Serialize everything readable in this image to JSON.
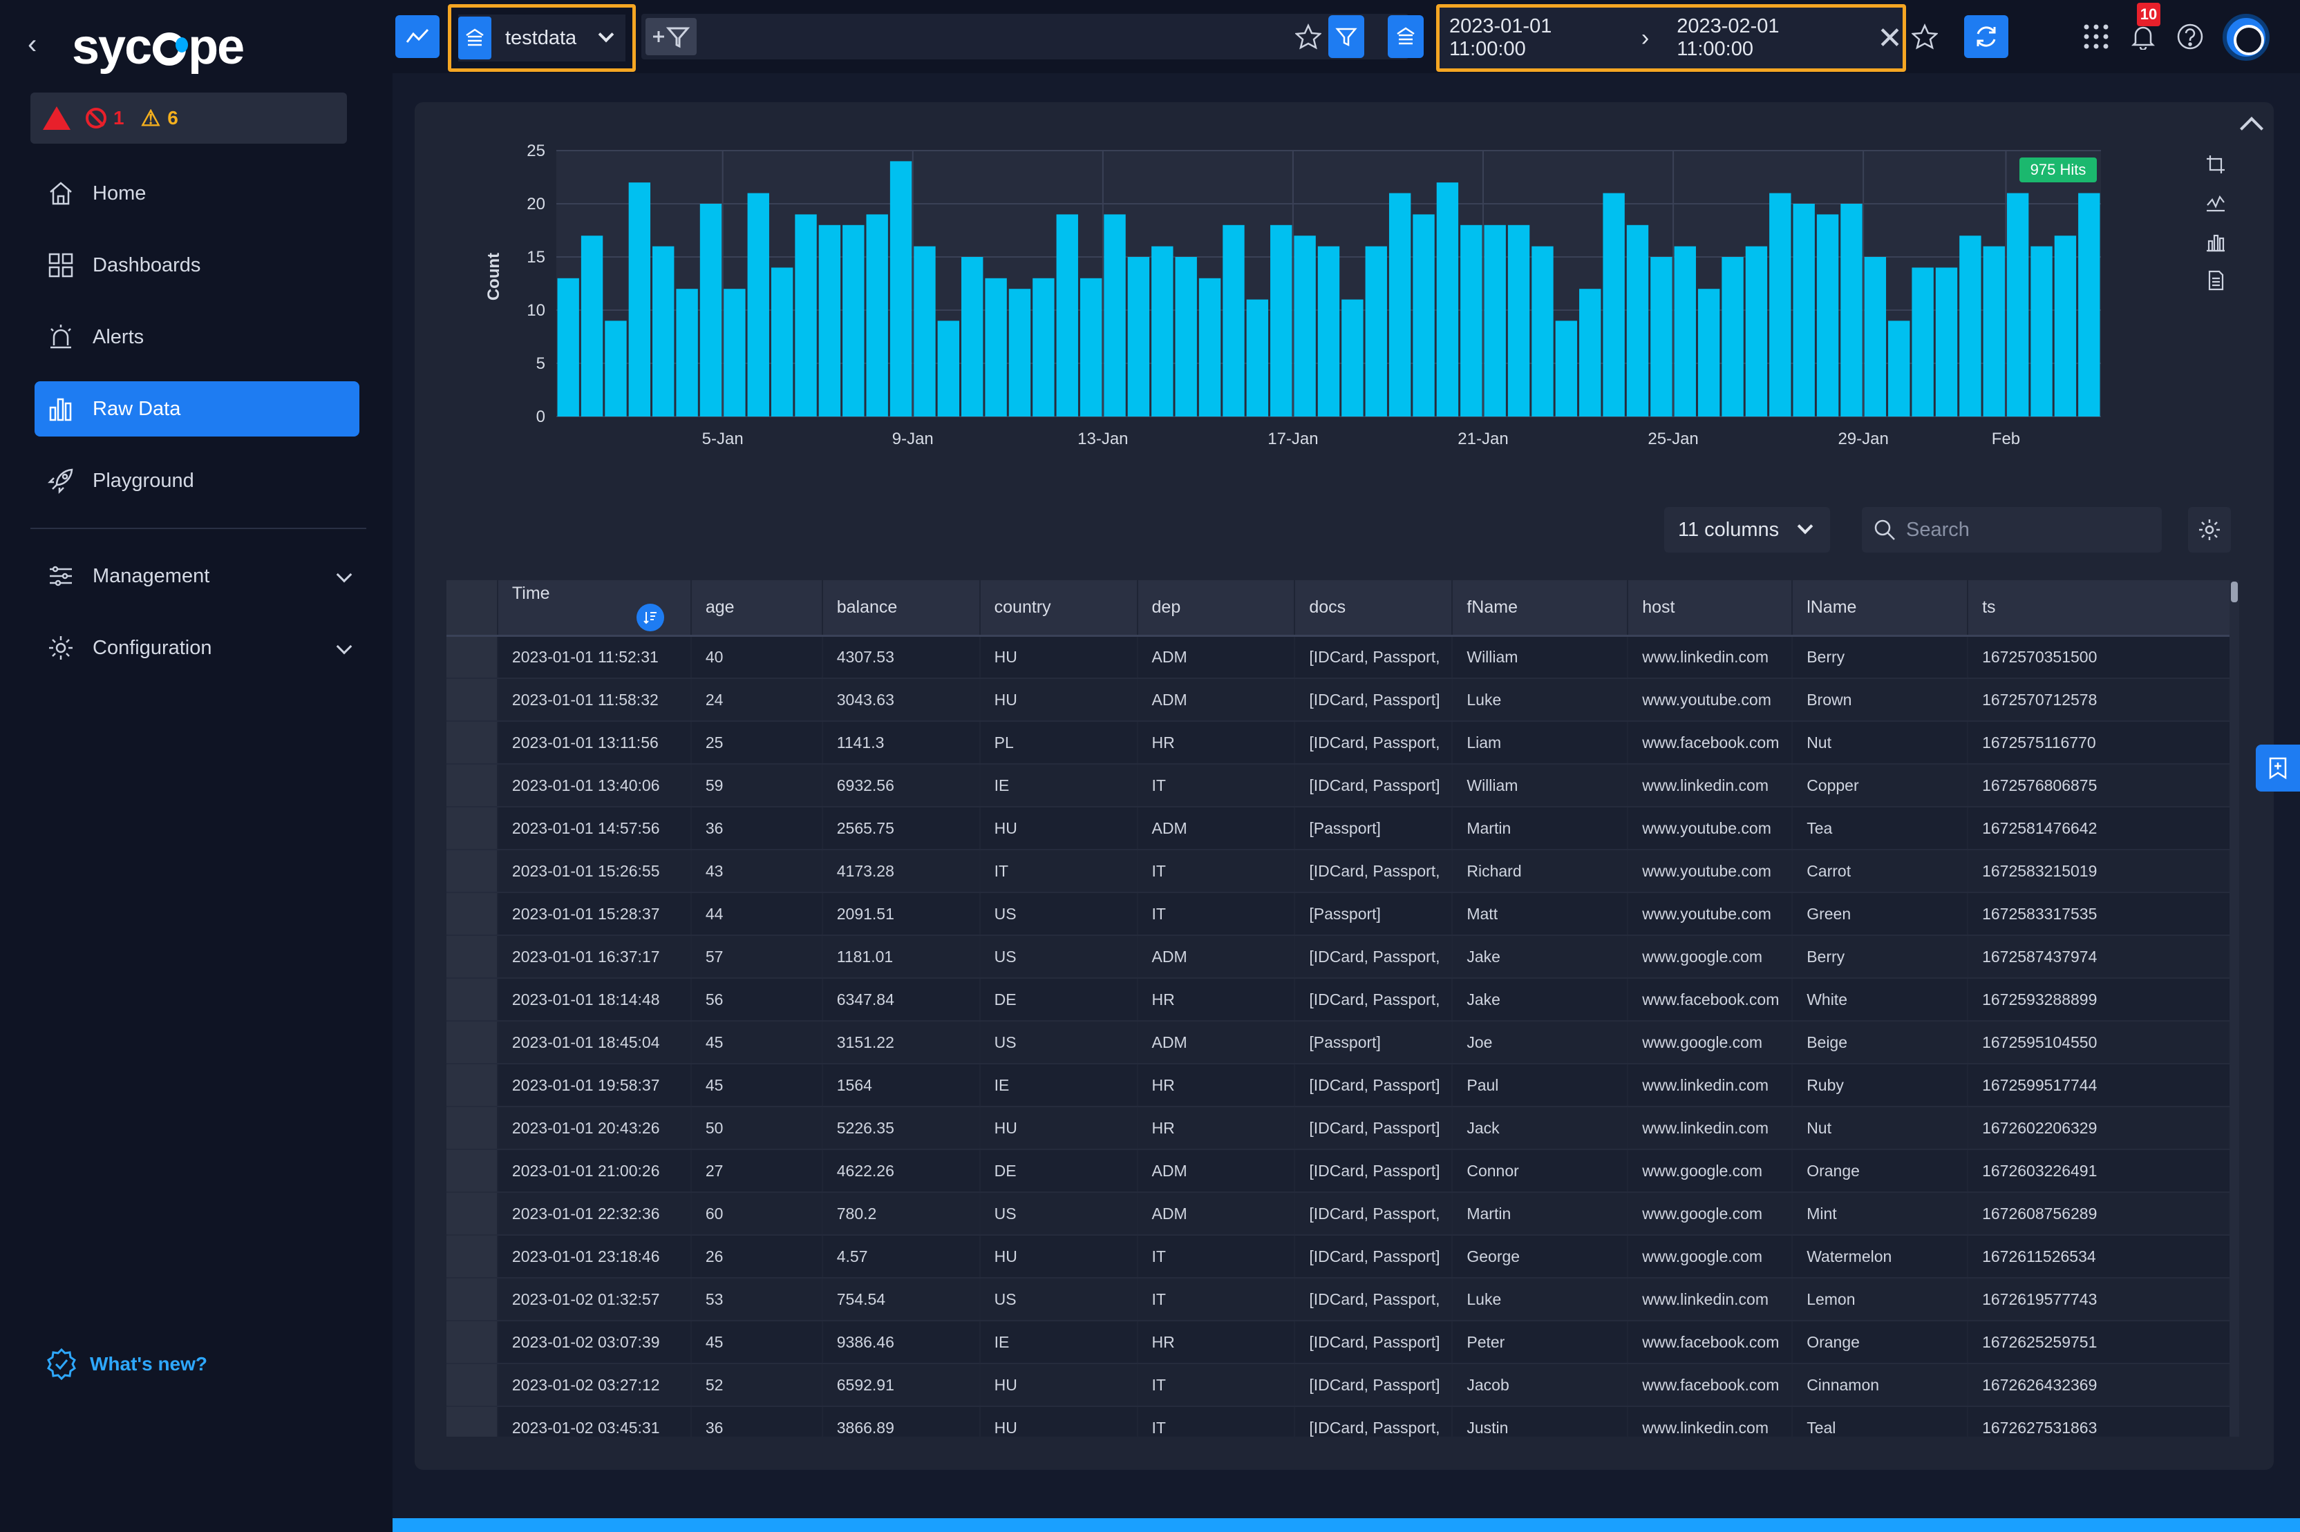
{
  "app": {
    "brand": "sycope"
  },
  "alerts": {
    "critical": "1",
    "warning": "6"
  },
  "sidebar": {
    "items": [
      {
        "label": "Home"
      },
      {
        "label": "Dashboards"
      },
      {
        "label": "Alerts"
      },
      {
        "label": "Raw Data"
      },
      {
        "label": "Playground"
      },
      {
        "label": "Management"
      },
      {
        "label": "Configuration"
      }
    ],
    "whats_new": "What's new?"
  },
  "topbar": {
    "source": "testdata",
    "date_from": "2023-01-01 11:00:00",
    "date_to": "2023-02-01 11:00:00",
    "notifications": "10"
  },
  "chart_data": {
    "type": "bar",
    "ylabel": "Count",
    "ylim": [
      0,
      25
    ],
    "yticks": [
      0,
      5,
      10,
      15,
      20,
      25
    ],
    "xticks": [
      {
        "label": "5-Jan",
        "index": 7
      },
      {
        "label": "9-Jan",
        "index": 15
      },
      {
        "label": "13-Jan",
        "index": 23
      },
      {
        "label": "17-Jan",
        "index": 31
      },
      {
        "label": "21-Jan",
        "index": 39
      },
      {
        "label": "25-Jan",
        "index": 47
      },
      {
        "label": "29-Jan",
        "index": 55
      },
      {
        "label": "Feb",
        "index": 61
      }
    ],
    "values": [
      13,
      17,
      9,
      22,
      16,
      12,
      20,
      12,
      21,
      14,
      19,
      18,
      18,
      19,
      24,
      16,
      9,
      15,
      13,
      12,
      13,
      19,
      13,
      19,
      15,
      16,
      15,
      13,
      18,
      11,
      18,
      17,
      16,
      11,
      16,
      21,
      19,
      22,
      18,
      18,
      18,
      16,
      9,
      12,
      21,
      18,
      15,
      16,
      12,
      15,
      16,
      21,
      20,
      19,
      20,
      15,
      9,
      14,
      14,
      17,
      16,
      21,
      16,
      17,
      21
    ],
    "grid": true,
    "hits_label": "975 Hits",
    "color": "#00c0f0"
  },
  "table": {
    "columns_label": "11 columns",
    "search_placeholder": "Search",
    "headers": [
      "Time",
      "age",
      "balance",
      "country",
      "dep",
      "docs",
      "fName",
      "host",
      "lName",
      "ts"
    ],
    "rows": [
      [
        "2023-01-01 11:52:31",
        "40",
        "4307.53",
        "HU",
        "ADM",
        "[IDCard, Passport,",
        "William",
        "www.linkedin.com",
        "Berry",
        "1672570351500"
      ],
      [
        "2023-01-01 11:58:32",
        "24",
        "3043.63",
        "HU",
        "ADM",
        "[IDCard, Passport]",
        "Luke",
        "www.youtube.com",
        "Brown",
        "1672570712578"
      ],
      [
        "2023-01-01 13:11:56",
        "25",
        "1141.3",
        "PL",
        "HR",
        "[IDCard, Passport,",
        "Liam",
        "www.facebook.com",
        "Nut",
        "1672575116770"
      ],
      [
        "2023-01-01 13:40:06",
        "59",
        "6932.56",
        "IE",
        "IT",
        "[IDCard, Passport]",
        "William",
        "www.linkedin.com",
        "Copper",
        "1672576806875"
      ],
      [
        "2023-01-01 14:57:56",
        "36",
        "2565.75",
        "HU",
        "ADM",
        "[Passport]",
        "Martin",
        "www.youtube.com",
        "Tea",
        "1672581476642"
      ],
      [
        "2023-01-01 15:26:55",
        "43",
        "4173.28",
        "IT",
        "IT",
        "[IDCard, Passport,",
        "Richard",
        "www.youtube.com",
        "Carrot",
        "1672583215019"
      ],
      [
        "2023-01-01 15:28:37",
        "44",
        "2091.51",
        "US",
        "IT",
        "[Passport]",
        "Matt",
        "www.youtube.com",
        "Green",
        "1672583317535"
      ],
      [
        "2023-01-01 16:37:17",
        "57",
        "1181.01",
        "US",
        "ADM",
        "[IDCard, Passport,",
        "Jake",
        "www.google.com",
        "Berry",
        "1672587437974"
      ],
      [
        "2023-01-01 18:14:48",
        "56",
        "6347.84",
        "DE",
        "HR",
        "[IDCard, Passport,",
        "Jake",
        "www.facebook.com",
        "White",
        "1672593288899"
      ],
      [
        "2023-01-01 18:45:04",
        "45",
        "3151.22",
        "US",
        "ADM",
        "[Passport]",
        "Joe",
        "www.google.com",
        "Beige",
        "1672595104550"
      ],
      [
        "2023-01-01 19:58:37",
        "45",
        "1564",
        "IE",
        "HR",
        "[IDCard, Passport]",
        "Paul",
        "www.linkedin.com",
        "Ruby",
        "1672599517744"
      ],
      [
        "2023-01-01 20:43:26",
        "50",
        "5226.35",
        "HU",
        "HR",
        "[IDCard, Passport]",
        "Jack",
        "www.linkedin.com",
        "Nut",
        "1672602206329"
      ],
      [
        "2023-01-01 21:00:26",
        "27",
        "4622.26",
        "DE",
        "ADM",
        "[IDCard, Passport]",
        "Connor",
        "www.google.com",
        "Orange",
        "1672603226491"
      ],
      [
        "2023-01-01 22:32:36",
        "60",
        "780.2",
        "US",
        "ADM",
        "[IDCard, Passport,",
        "Martin",
        "www.google.com",
        "Mint",
        "1672608756289"
      ],
      [
        "2023-01-01 23:18:46",
        "26",
        "4.57",
        "HU",
        "IT",
        "[IDCard, Passport]",
        "George",
        "www.google.com",
        "Watermelon",
        "1672611526534"
      ],
      [
        "2023-01-02 01:32:57",
        "53",
        "754.54",
        "US",
        "IT",
        "[IDCard, Passport,",
        "Luke",
        "www.linkedin.com",
        "Lemon",
        "1672619577743"
      ],
      [
        "2023-01-02 03:07:39",
        "45",
        "9386.46",
        "IE",
        "HR",
        "[IDCard, Passport]",
        "Peter",
        "www.facebook.com",
        "Orange",
        "1672625259751"
      ],
      [
        "2023-01-02 03:27:12",
        "52",
        "6592.91",
        "HU",
        "IT",
        "[IDCard, Passport]",
        "Jacob",
        "www.facebook.com",
        "Cinnamon",
        "1672626432369"
      ],
      [
        "2023-01-02 03:45:31",
        "36",
        "3866.89",
        "HU",
        "IT",
        "[IDCard, Passport,",
        "Justin",
        "www.linkedin.com",
        "Teal",
        "1672627531863"
      ]
    ]
  }
}
